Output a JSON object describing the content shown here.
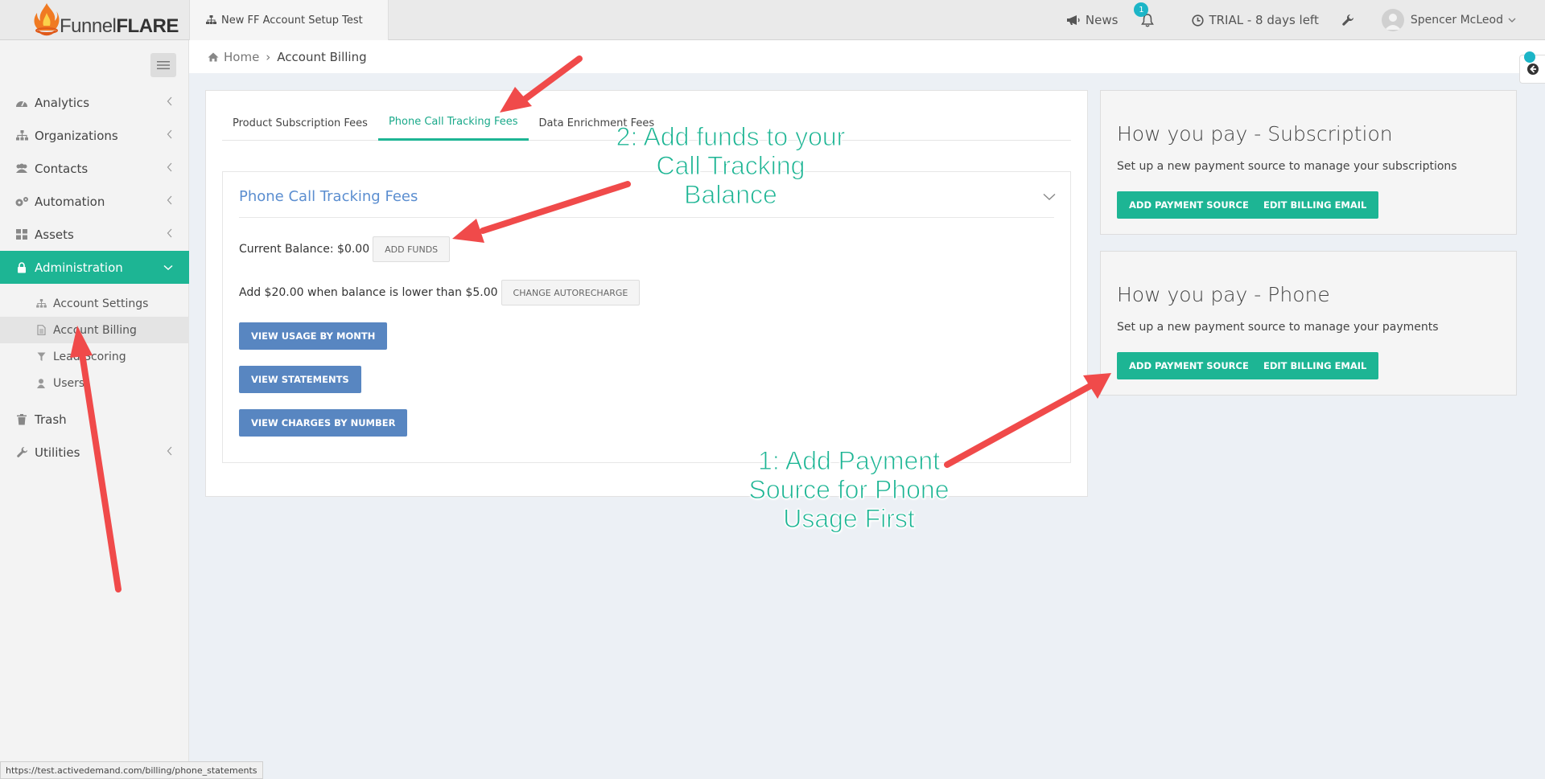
{
  "header": {
    "logo": {
      "word1": "Funnel",
      "word2": "FLARE"
    },
    "account_tab": "New FF Account Setup Test",
    "news_label": "News",
    "notification_count": "1",
    "trial_label": "TRIAL - 8 days left",
    "user_name": "Spencer McLeod"
  },
  "sidebar": {
    "items": [
      {
        "label": "Analytics",
        "icon": "tachometer-icon"
      },
      {
        "label": "Organizations",
        "icon": "sitemap-icon"
      },
      {
        "label": "Contacts",
        "icon": "users-icon"
      },
      {
        "label": "Automation",
        "icon": "cogs-icon"
      },
      {
        "label": "Assets",
        "icon": "grid-icon"
      },
      {
        "label": "Administration",
        "icon": "lock-icon"
      }
    ],
    "subitems": [
      {
        "label": "Account Settings",
        "icon": "sitemap-icon"
      },
      {
        "label": "Account Billing",
        "icon": "document-icon"
      },
      {
        "label": "Lead Scoring",
        "icon": "filter-icon"
      },
      {
        "label": "Users",
        "icon": "user-icon"
      }
    ],
    "trash": "Trash",
    "utilities": "Utilities"
  },
  "breadcrumb": {
    "home": "Home",
    "current": "Account Billing"
  },
  "tabs": [
    "Product Subscription Fees",
    "Phone Call Tracking Fees",
    "Data Enrichment Fees"
  ],
  "phone_panel": {
    "title": "Phone Call Tracking Fees",
    "balance_text": "Current Balance: $0.00",
    "add_funds": "ADD FUNDS",
    "autorecharge_text": "Add $20.00 when balance is lower than $5.00",
    "change_autorecharge": "CHANGE AUTORECHARGE",
    "view_usage": "VIEW USAGE BY MONTH",
    "view_statements": "VIEW STATEMENTS",
    "view_charges": "VIEW CHARGES BY NUMBER"
  },
  "pay_subscription": {
    "title": "How you pay - Subscription",
    "desc": "Set up a new payment source to manage your subscriptions",
    "add_source": "ADD PAYMENT SOURCE",
    "edit_email": "EDIT BILLING EMAIL"
  },
  "pay_phone": {
    "title": "How you pay - Phone",
    "desc": "Set up a new payment source to manage your payments",
    "add_source": "ADD PAYMENT SOURCE",
    "edit_email": "EDIT BILLING EMAIL"
  },
  "annotations": {
    "step2": [
      "2: Add funds to your",
      "Call Tracking",
      "Balance"
    ],
    "step1": [
      "1: Add Payment",
      "Source for Phone",
      "Usage First"
    ]
  },
  "status_url": "https://test.activedemand.com/billing/phone_statements",
  "colors": {
    "accent": "#1db594",
    "link_blue": "#5886c1",
    "arrow_red": "#f04a4a",
    "badge": "#1cb5c7"
  }
}
